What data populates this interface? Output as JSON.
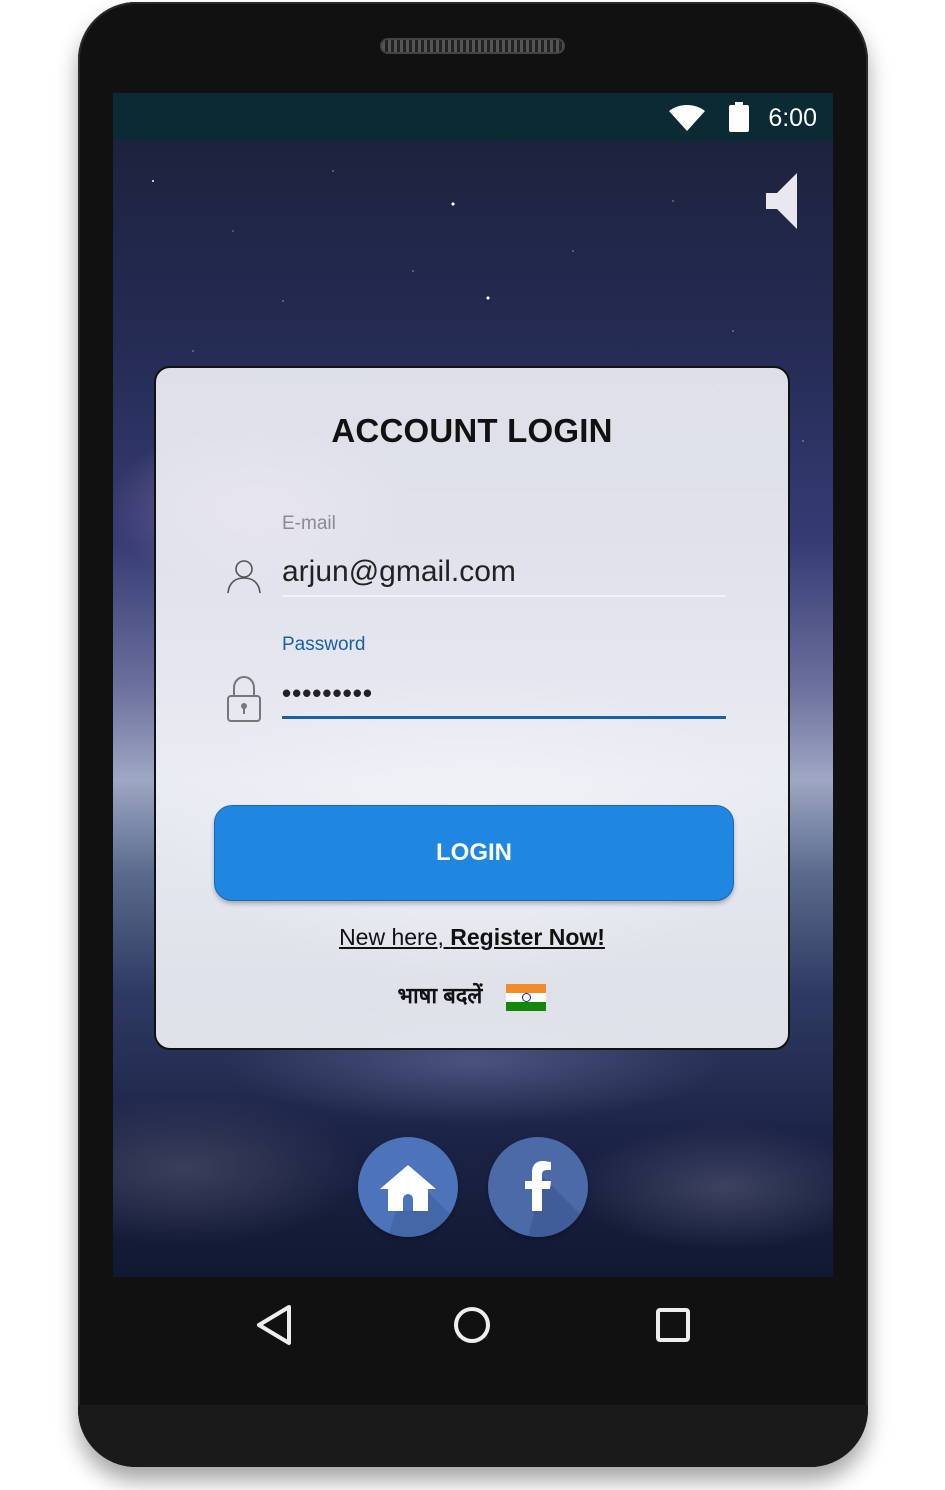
{
  "status_bar": {
    "time": "6:00",
    "wifi_icon": "wifi-icon",
    "battery_icon": "battery-icon"
  },
  "top_controls": {
    "volume_icon": "volume-icon"
  },
  "login_card": {
    "title": "ACCOUNT LOGIN",
    "email": {
      "label": "E-mail",
      "value": "arjun@gmail.com",
      "icon": "user-icon"
    },
    "password": {
      "label": "Password",
      "value": "•••••••••",
      "icon": "lock-icon"
    },
    "login_button": "LOGIN",
    "register": {
      "prefix": "New here, ",
      "link": "Register Now!"
    },
    "language": {
      "label": "भाषा बदलें",
      "flag_icon": "india-flag-icon"
    }
  },
  "social": {
    "home_icon": "home-icon",
    "facebook_icon": "facebook-icon"
  },
  "nav_bar": {
    "back_icon": "back-triangle-icon",
    "home_icon": "home-circle-icon",
    "recents_icon": "recents-square-icon"
  },
  "colors": {
    "accent": "#1f87e0",
    "status_bar": "#0b2a33",
    "focus_underline": "#1a5fa8"
  }
}
